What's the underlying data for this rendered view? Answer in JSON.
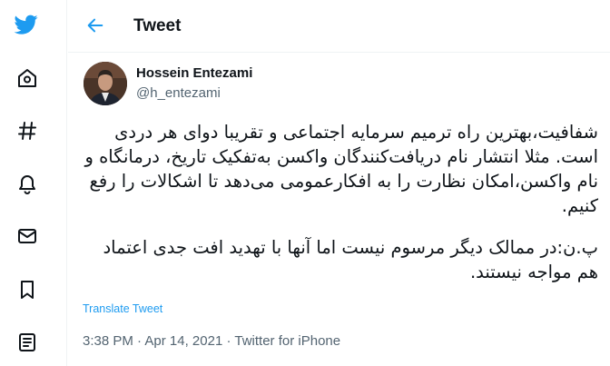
{
  "sidebar": {
    "items": [
      {
        "name": "twitter-logo-icon",
        "interactable": true
      },
      {
        "name": "home-icon",
        "interactable": true
      },
      {
        "name": "explore-hashtag-icon",
        "interactable": true
      },
      {
        "name": "notifications-bell-icon",
        "interactable": true
      },
      {
        "name": "messages-mail-icon",
        "interactable": true
      },
      {
        "name": "bookmarks-icon",
        "interactable": true
      },
      {
        "name": "lists-icon",
        "interactable": true
      }
    ],
    "accent_color": "#1d9bf0",
    "icon_color": "#0f1419"
  },
  "header": {
    "title": "Tweet"
  },
  "tweet": {
    "author_name": "Hossein Entezami",
    "author_handle": "@h_entezami",
    "paragraphs": [
      "شفافیت،بهترین راه ترمیم سرمایه اجتماعی و تقریبا دوای هر دردی است. مثلا انتشار نام دریافت‌کنندگان واکسن به‌تفکیک تاریخ، درمانگاه و نام واکسن،امکان نظارت را به افکارعمومی می‌دهد تا اشکالات را رفع کنیم.",
      "پ.ن:در ممالک دیگر مرسوم نیست اما آنها با تهدید افت جدی اعتماد هم مواجه نیستند."
    ],
    "translate_label": "Translate Tweet",
    "time": "3:38 PM",
    "separator": "·",
    "date": "Apr 14, 2021",
    "source": "Twitter for iPhone"
  }
}
